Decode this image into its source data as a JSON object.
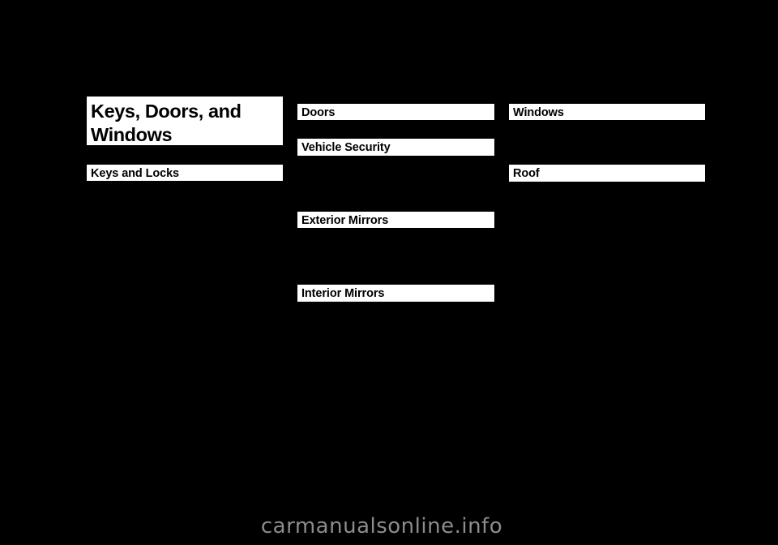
{
  "document": {
    "chapter_title": "Keys, Doors, and\nWindows"
  },
  "columns": {
    "left": {
      "sections": [
        {
          "heading": "Keys and Locks",
          "entries": []
        }
      ]
    },
    "middle": {
      "sections": [
        {
          "heading": "Doors",
          "entries": []
        },
        {
          "heading": "Vehicle Security",
          "clipped_entry": {
            "label": "",
            "page": ""
          },
          "entries": []
        },
        {
          "heading": "Exterior Mirrors",
          "entries": []
        },
        {
          "heading": "Interior Mirrors",
          "clipped_entry": {
            "label": "",
            "page": ""
          },
          "entries": []
        }
      ]
    },
    "right": {
      "sections": [
        {
          "heading": "Windows",
          "entries": []
        },
        {
          "heading": "Roof",
          "clipped_entry": {
            "label": "",
            "page": ""
          },
          "entries": []
        }
      ]
    }
  },
  "footer": {
    "watermark": "carmanualsonline.info"
  }
}
